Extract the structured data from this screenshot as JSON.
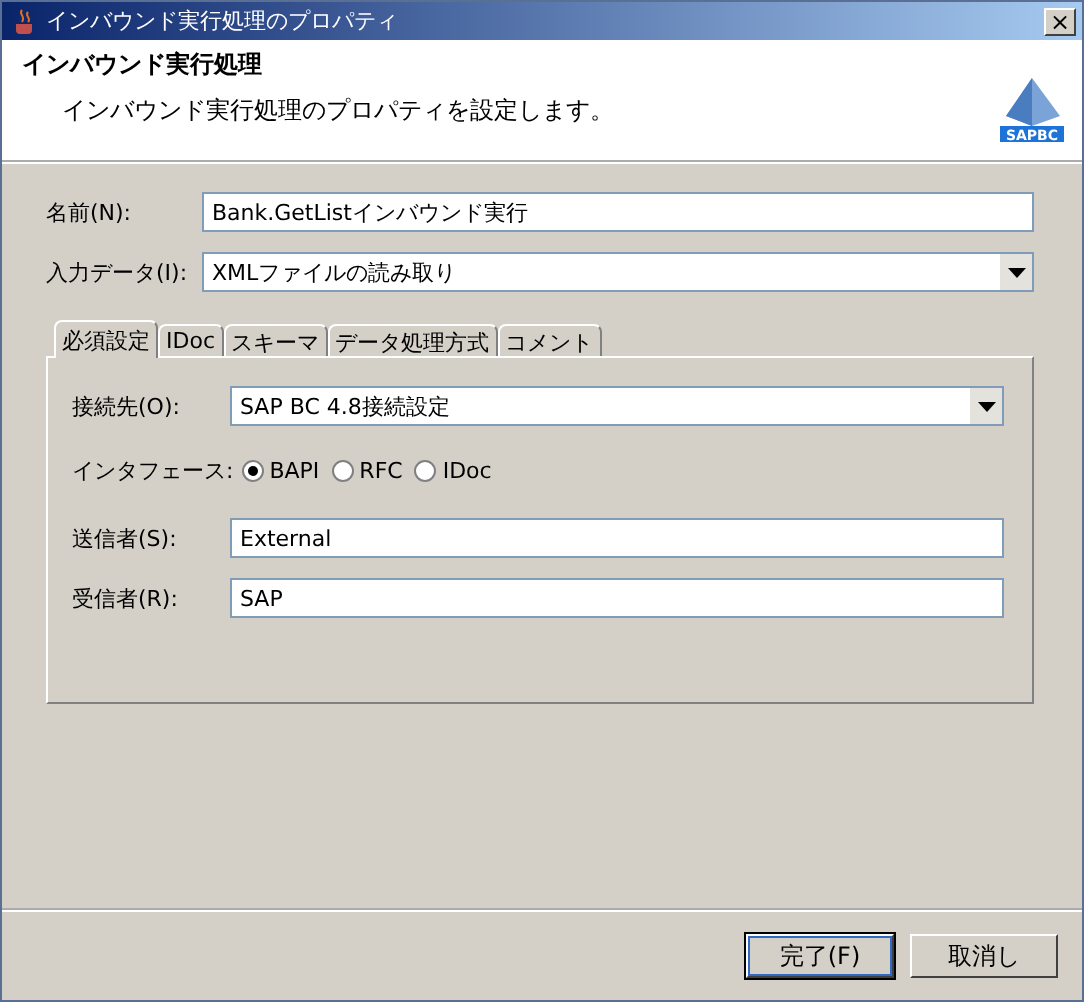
{
  "window": {
    "title": "インバウンド実行処理のプロパティ",
    "close": "×"
  },
  "header": {
    "title": "インバウンド実行処理",
    "description": "インバウンド実行処理のプロパティを設定します。",
    "logo_text": "SAPBC"
  },
  "fields": [
    {
      "kind": "text",
      "label": "名前(N):",
      "value": "Bank.GetListインバウンド実行"
    },
    {
      "kind": "dropdown",
      "label": "入力データ(I):",
      "value": "XMLファイルの読み取り"
    }
  ],
  "tabs": [
    {
      "label": "必須設定",
      "selected": true
    },
    {
      "label": "IDoc",
      "selected": false
    },
    {
      "label": "スキーマ",
      "selected": false
    },
    {
      "label": "データ処理方式",
      "selected": false
    },
    {
      "label": "コメント",
      "selected": false
    }
  ],
  "tab_fields": [
    {
      "kind": "dropdown",
      "label": "接続先(O):",
      "value": "SAP BC 4.8接続設定"
    },
    {
      "kind": "radio",
      "label": "インタフェース:",
      "options": [
        {
          "label": "BAPI",
          "selected": true
        },
        {
          "label": "RFC",
          "selected": false
        },
        {
          "label": "IDoc",
          "selected": false
        }
      ]
    },
    {
      "kind": "text",
      "label": "送信者(S):",
      "value": "External"
    },
    {
      "kind": "text",
      "label": "受信者(R):",
      "value": "SAP"
    }
  ],
  "buttons": [
    {
      "label": "完了(F)",
      "default": true
    },
    {
      "label": "取消し",
      "default": false
    }
  ]
}
